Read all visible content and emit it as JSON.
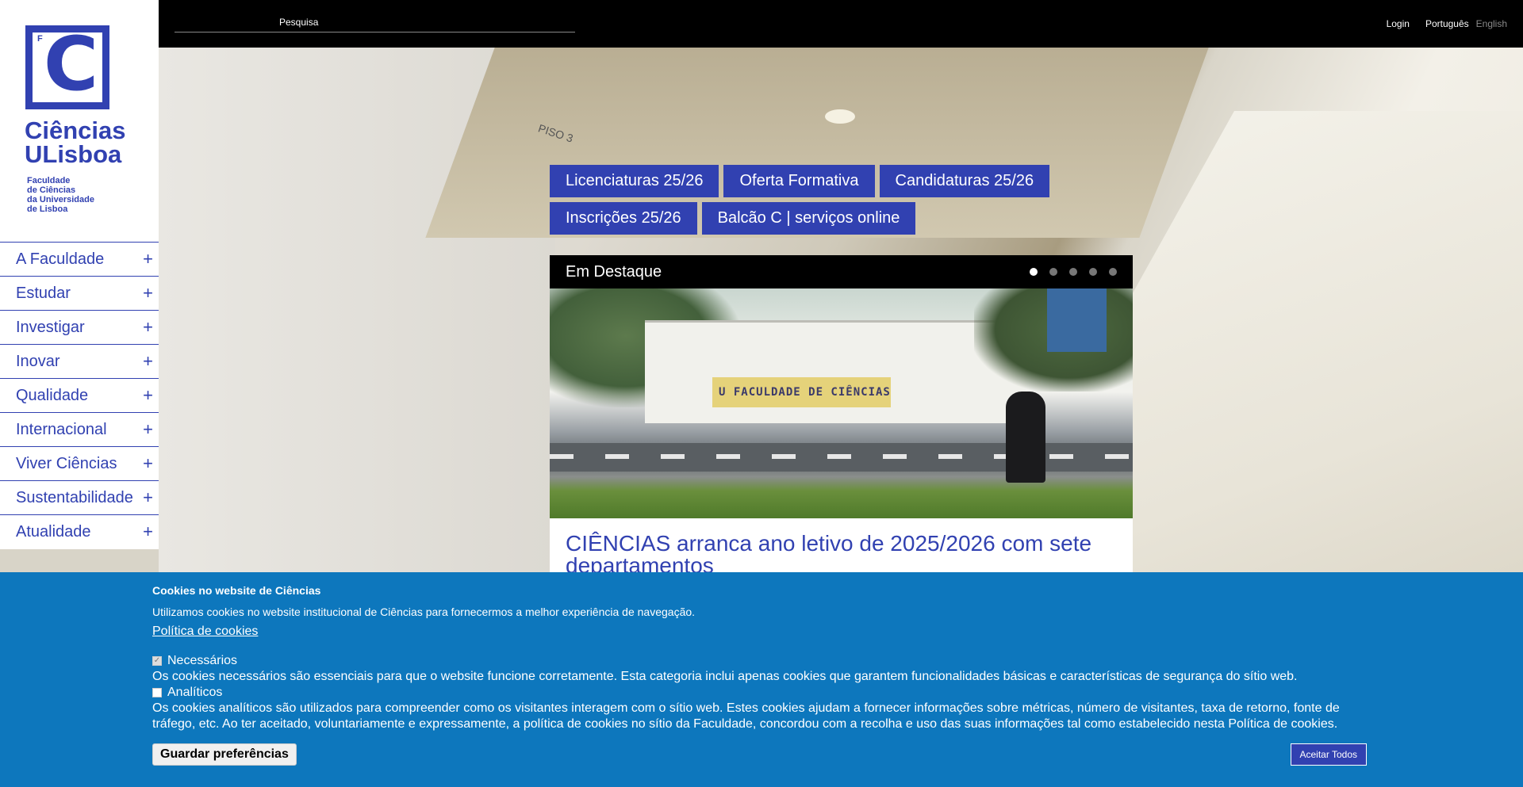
{
  "topbar": {
    "search_placeholder": "Pesquisa",
    "login": "Login",
    "lang_pt": "Português",
    "lang_en": "English"
  },
  "logo": {
    "small_letter": "F",
    "big_letter": "C",
    "name_line1": "Ciências",
    "name_line2": "ULisboa",
    "sub_line1": "Faculdade",
    "sub_line2": "de Ciências",
    "sub_line3": "da Universidade",
    "sub_line4": "de Lisboa"
  },
  "menu": {
    "items": [
      {
        "label": "A Faculdade"
      },
      {
        "label": "Estudar"
      },
      {
        "label": "Investigar"
      },
      {
        "label": "Inovar"
      },
      {
        "label": "Qualidade"
      },
      {
        "label": "Internacional"
      },
      {
        "label": "Viver Ciências"
      },
      {
        "label": "Sustentabilidade"
      },
      {
        "label": "Atualidade"
      }
    ],
    "expand_symbol": "+"
  },
  "quick_links": {
    "row1": [
      "Licenciaturas 25/26",
      "Oferta Formativa",
      "Candidaturas 25/26"
    ],
    "row2": [
      "Inscrições 25/26",
      "Balcão C | serviços online"
    ]
  },
  "background": {
    "floor_label": "PISO 3"
  },
  "feature": {
    "heading": "Em Destaque",
    "slides_total": 5,
    "active_slide": 1,
    "image_sign": "U   FACULDADE DE CIÊNCIAS",
    "title": "CIÊNCIAS arranca ano letivo de 2025/2026 com sete departamentos"
  },
  "cookies": {
    "title": "Cookies no website de Ciências",
    "intro": "Utilizamos cookies no website institucional de Ciências para fornecermos a melhor experiência de navegação.",
    "policy_link": "Política de cookies",
    "necessary_label": "Necessários",
    "necessary_desc": "Os cookies necessários são essenciais para que o website funcione corretamente. Esta categoria inclui apenas cookies que garantem funcionalidades básicas e características de segurança do sítio web.",
    "analytics_label": "Analíticos",
    "analytics_desc": "Os cookies analíticos são utilizados para compreender como os visitantes interagem com o sítio web. Estes cookies ajudam a fornecer informações sobre métricas, número de visitantes, taxa de retorno, fonte de tráfego, etc. Ao ter aceitado, voluntariamente e expressamente, a política de cookies no sítio da Faculdade, concordou com a recolha e uso das suas informações tal como estabelecido nesta Política de cookies.",
    "save_button": "Guardar preferências",
    "accept_button": "Aceitar Todos"
  },
  "colors": {
    "brand_blue": "#3141b1",
    "cookie_blue": "#0d77bd"
  }
}
